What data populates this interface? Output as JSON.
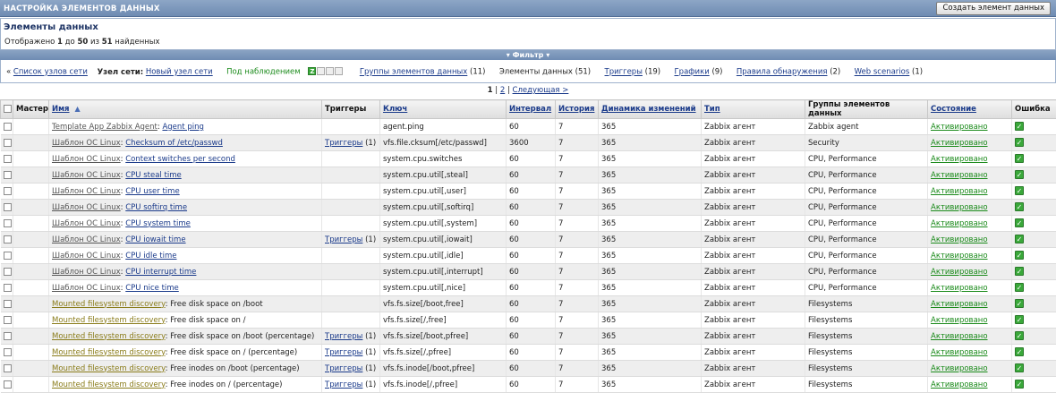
{
  "header": {
    "title": "НАСТРОЙКА ЭЛЕМЕНТОВ ДАННЫХ",
    "create_button": "Создать элемент данных"
  },
  "summary": {
    "heading": "Элементы данных",
    "shown_prefix": "Отображено",
    "from": "1",
    "to_word": "до",
    "to": "50",
    "of_word": "из",
    "total": "51",
    "found_word": "найденных"
  },
  "filter": {
    "label": "Фильтр"
  },
  "nav": {
    "back_prefix": "«",
    "host_list": "Список узлов сети",
    "host_label": "Узел сети:",
    "host_name": "Новый узел сети",
    "monitored": "Под наблюдением",
    "status_icons": [
      "Z",
      "",
      "",
      ""
    ],
    "applications": "Группы элементов данных",
    "applications_count": "(11)",
    "items": "Элементы данных",
    "items_count": "(51)",
    "triggers": "Триггеры",
    "triggers_count": "(19)",
    "graphs": "Графики",
    "graphs_count": "(9)",
    "discovery": "Правила обнаружения",
    "discovery_count": "(2)",
    "web": "Web scenarios",
    "web_count": "(1)"
  },
  "pager": {
    "current": "1",
    "sep": "|",
    "page2": "2",
    "next": "Следующая >"
  },
  "table": {
    "columns": {
      "master": "Мастер",
      "name": "Имя",
      "triggers": "Триггеры",
      "key": "Ключ",
      "interval": "Интервал",
      "history": "История",
      "trends": "Динамика изменений",
      "type": "Тип",
      "applications": "Группы элементов данных",
      "status": "Состояние",
      "error": "Ошибка"
    },
    "sort_icon": "sort-up-arrow-icon",
    "rows": [
      {
        "tmpl": "Template App Zabbix Agent",
        "disc": false,
        "name": "Agent ping",
        "name_link": true,
        "trig": "",
        "trig_count": "",
        "key": "agent.ping",
        "interval": "60",
        "history": "7",
        "trends": "365",
        "type": "Zabbix агент",
        "apps": "Zabbix agent",
        "status": "Активировано"
      },
      {
        "tmpl": "Шаблон ОС Linux",
        "disc": false,
        "name": "Checksum of /etc/passwd",
        "name_link": true,
        "trig": "Триггеры",
        "trig_count": "(1)",
        "key": "vfs.file.cksum[/etc/passwd]",
        "interval": "3600",
        "history": "7",
        "trends": "365",
        "type": "Zabbix агент",
        "apps": "Security",
        "status": "Активировано"
      },
      {
        "tmpl": "Шаблон ОС Linux",
        "disc": false,
        "name": "Context switches per second",
        "name_link": true,
        "trig": "",
        "trig_count": "",
        "key": "system.cpu.switches",
        "interval": "60",
        "history": "7",
        "trends": "365",
        "type": "Zabbix агент",
        "apps": "CPU, Performance",
        "status": "Активировано"
      },
      {
        "tmpl": "Шаблон ОС Linux",
        "disc": false,
        "name": "CPU steal time",
        "name_link": true,
        "trig": "",
        "trig_count": "",
        "key": "system.cpu.util[,steal]",
        "interval": "60",
        "history": "7",
        "trends": "365",
        "type": "Zabbix агент",
        "apps": "CPU, Performance",
        "status": "Активировано"
      },
      {
        "tmpl": "Шаблон ОС Linux",
        "disc": false,
        "name": "CPU user time",
        "name_link": true,
        "trig": "",
        "trig_count": "",
        "key": "system.cpu.util[,user]",
        "interval": "60",
        "history": "7",
        "trends": "365",
        "type": "Zabbix агент",
        "apps": "CPU, Performance",
        "status": "Активировано"
      },
      {
        "tmpl": "Шаблон ОС Linux",
        "disc": false,
        "name": "CPU softirq time",
        "name_link": true,
        "trig": "",
        "trig_count": "",
        "key": "system.cpu.util[,softirq]",
        "interval": "60",
        "history": "7",
        "trends": "365",
        "type": "Zabbix агент",
        "apps": "CPU, Performance",
        "status": "Активировано"
      },
      {
        "tmpl": "Шаблон ОС Linux",
        "disc": false,
        "name": "CPU system time",
        "name_link": true,
        "trig": "",
        "trig_count": "",
        "key": "system.cpu.util[,system]",
        "interval": "60",
        "history": "7",
        "trends": "365",
        "type": "Zabbix агент",
        "apps": "CPU, Performance",
        "status": "Активировано"
      },
      {
        "tmpl": "Шаблон ОС Linux",
        "disc": false,
        "name": "CPU iowait time",
        "name_link": true,
        "trig": "Триггеры",
        "trig_count": "(1)",
        "key": "system.cpu.util[,iowait]",
        "interval": "60",
        "history": "7",
        "trends": "365",
        "type": "Zabbix агент",
        "apps": "CPU, Performance",
        "status": "Активировано"
      },
      {
        "tmpl": "Шаблон ОС Linux",
        "disc": false,
        "name": "CPU idle time",
        "name_link": true,
        "trig": "",
        "trig_count": "",
        "key": "system.cpu.util[,idle]",
        "interval": "60",
        "history": "7",
        "trends": "365",
        "type": "Zabbix агент",
        "apps": "CPU, Performance",
        "status": "Активировано"
      },
      {
        "tmpl": "Шаблон ОС Linux",
        "disc": false,
        "name": "CPU interrupt time",
        "name_link": true,
        "trig": "",
        "trig_count": "",
        "key": "system.cpu.util[,interrupt]",
        "interval": "60",
        "history": "7",
        "trends": "365",
        "type": "Zabbix агент",
        "apps": "CPU, Performance",
        "status": "Активировано"
      },
      {
        "tmpl": "Шаблон ОС Linux",
        "disc": false,
        "name": "CPU nice time",
        "name_link": true,
        "trig": "",
        "trig_count": "",
        "key": "system.cpu.util[,nice]",
        "interval": "60",
        "history": "7",
        "trends": "365",
        "type": "Zabbix агент",
        "apps": "CPU, Performance",
        "status": "Активировано"
      },
      {
        "tmpl": "Mounted filesystem discovery",
        "disc": true,
        "name": "Free disk space on /boot",
        "name_link": false,
        "trig": "",
        "trig_count": "",
        "key": "vfs.fs.size[/boot,free]",
        "interval": "60",
        "history": "7",
        "trends": "365",
        "type": "Zabbix агент",
        "apps": "Filesystems",
        "status": "Активировано"
      },
      {
        "tmpl": "Mounted filesystem discovery",
        "disc": true,
        "name": "Free disk space on /",
        "name_link": false,
        "trig": "",
        "trig_count": "",
        "key": "vfs.fs.size[/,free]",
        "interval": "60",
        "history": "7",
        "trends": "365",
        "type": "Zabbix агент",
        "apps": "Filesystems",
        "status": "Активировано"
      },
      {
        "tmpl": "Mounted filesystem discovery",
        "disc": true,
        "name": "Free disk space on /boot (percentage)",
        "name_link": false,
        "trig": "Триггеры",
        "trig_count": "(1)",
        "key": "vfs.fs.size[/boot,pfree]",
        "interval": "60",
        "history": "7",
        "trends": "365",
        "type": "Zabbix агент",
        "apps": "Filesystems",
        "status": "Активировано"
      },
      {
        "tmpl": "Mounted filesystem discovery",
        "disc": true,
        "name": "Free disk space on / (percentage)",
        "name_link": false,
        "trig": "Триггеры",
        "trig_count": "(1)",
        "key": "vfs.fs.size[/,pfree]",
        "interval": "60",
        "history": "7",
        "trends": "365",
        "type": "Zabbix агент",
        "apps": "Filesystems",
        "status": "Активировано"
      },
      {
        "tmpl": "Mounted filesystem discovery",
        "disc": true,
        "name": "Free inodes on /boot (percentage)",
        "name_link": false,
        "trig": "Триггеры",
        "trig_count": "(1)",
        "key": "vfs.fs.inode[/boot,pfree]",
        "interval": "60",
        "history": "7",
        "trends": "365",
        "type": "Zabbix агент",
        "apps": "Filesystems",
        "status": "Активировано"
      },
      {
        "tmpl": "Mounted filesystem discovery",
        "disc": true,
        "name": "Free inodes on / (percentage)",
        "name_link": false,
        "trig": "Триггеры",
        "trig_count": "(1)",
        "key": "vfs.fs.inode[/,pfree]",
        "interval": "60",
        "history": "7",
        "trends": "365",
        "type": "Zabbix агент",
        "apps": "Filesystems",
        "status": "Активировано"
      }
    ]
  },
  "colors": {
    "header_bg": "#7a96bb",
    "link": "#1a3a8a",
    "status_enabled": "#1a8a1a",
    "discovery_link": "#8a7c1a",
    "row_alt": "#eeeeee"
  }
}
